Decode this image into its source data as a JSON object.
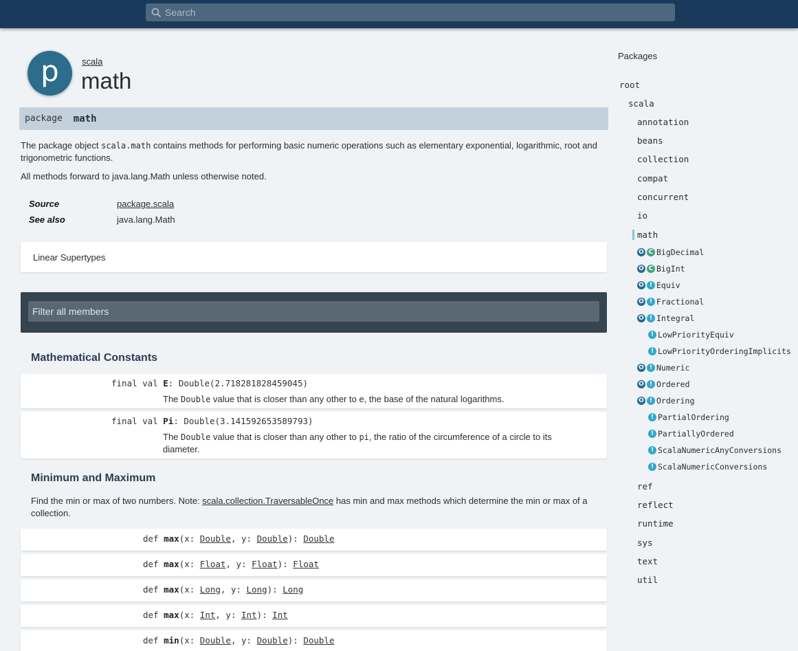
{
  "search": {
    "placeholder": "Search"
  },
  "header": {
    "icon_letter": "p",
    "parent": "scala",
    "title": "math"
  },
  "signature": {
    "keyword": "package",
    "name": "math"
  },
  "description": {
    "p1_pre": "The package object ",
    "p1_code": "scala.math",
    "p1_post": " contains methods for performing basic numeric operations such as elementary exponential, logarithmic, root and trigonometric functions.",
    "p2": "All methods forward to java.lang.Math unless otherwise noted."
  },
  "attributes": [
    {
      "label": "Source",
      "value": "package.scala",
      "link": true
    },
    {
      "label": "See also",
      "value": "java.lang.Math",
      "link": false
    }
  ],
  "linear_supertypes": "Linear Supertypes",
  "filter": {
    "placeholder": "Filter all members"
  },
  "groups": {
    "constants": {
      "title": "Mathematical Constants",
      "members": [
        {
          "prefix": "final val ",
          "name": "E",
          "suffix": ": Double(2.718281828459045)",
          "desc_pre": "The ",
          "desc_code": "Double",
          "desc_mid": " value that is closer than any other to ",
          "desc_code2": "e",
          "desc_post": ", the base of the natural logarithms."
        },
        {
          "prefix": "final val ",
          "name": "Pi",
          "suffix": ": Double(3.141592653589793)",
          "desc_pre": "The ",
          "desc_code": "Double",
          "desc_mid": " value that is closer than any other to ",
          "desc_code2": "pi",
          "desc_post": ", the ratio of the circumference of a circle to its diameter."
        }
      ]
    },
    "minmax": {
      "title": "Minimum and Maximum",
      "desc_pre": "Find the min or max of two numbers. Note: ",
      "desc_link": "scala.collection.TraversableOnce",
      "desc_post": " has min and max methods which determine the min or max of a collection.",
      "members": [
        {
          "name": "max",
          "type": "Double"
        },
        {
          "name": "max",
          "type": "Float"
        },
        {
          "name": "max",
          "type": "Long"
        },
        {
          "name": "max",
          "type": "Int"
        },
        {
          "name": "min",
          "type": "Double"
        }
      ],
      "def_kw": "def ",
      "x_param": "x: ",
      "y_param": ", y: ",
      "close": "): ",
      "open": "("
    }
  },
  "sidebar": {
    "title": "Packages",
    "root": "root",
    "scala": "scala",
    "packages_before": [
      "annotation",
      "beans",
      "collection",
      "compat",
      "concurrent",
      "io"
    ],
    "active": "math",
    "classes": [
      {
        "badges": [
          "o",
          "c"
        ],
        "name": "BigDecimal",
        "indent": 0
      },
      {
        "badges": [
          "o",
          "c"
        ],
        "name": "BigInt",
        "indent": 0
      },
      {
        "badges": [
          "o",
          "t"
        ],
        "name": "Equiv",
        "indent": 0
      },
      {
        "badges": [
          "o",
          "t"
        ],
        "name": "Fractional",
        "indent": 0
      },
      {
        "badges": [
          "o",
          "t"
        ],
        "name": "Integral",
        "indent": 0
      },
      {
        "badges": [
          "t"
        ],
        "name": "LowPriorityEquiv",
        "indent": 1
      },
      {
        "badges": [
          "t"
        ],
        "name": "LowPriorityOrderingImplicits",
        "indent": 1
      },
      {
        "badges": [
          "o",
          "t"
        ],
        "name": "Numeric",
        "indent": 0
      },
      {
        "badges": [
          "o",
          "t"
        ],
        "name": "Ordered",
        "indent": 0
      },
      {
        "badges": [
          "o",
          "t"
        ],
        "name": "Ordering",
        "indent": 0
      },
      {
        "badges": [
          "t"
        ],
        "name": "PartialOrdering",
        "indent": 1
      },
      {
        "badges": [
          "t"
        ],
        "name": "PartiallyOrdered",
        "indent": 1
      },
      {
        "badges": [
          "t"
        ],
        "name": "ScalaNumericAnyConversions",
        "indent": 1
      },
      {
        "badges": [
          "t"
        ],
        "name": "ScalaNumericConversions",
        "indent": 1
      }
    ],
    "packages_after": [
      "ref",
      "reflect",
      "runtime",
      "sys",
      "text",
      "util"
    ],
    "badge_letters": {
      "o": "O",
      "c": "C",
      "t": "T"
    }
  }
}
